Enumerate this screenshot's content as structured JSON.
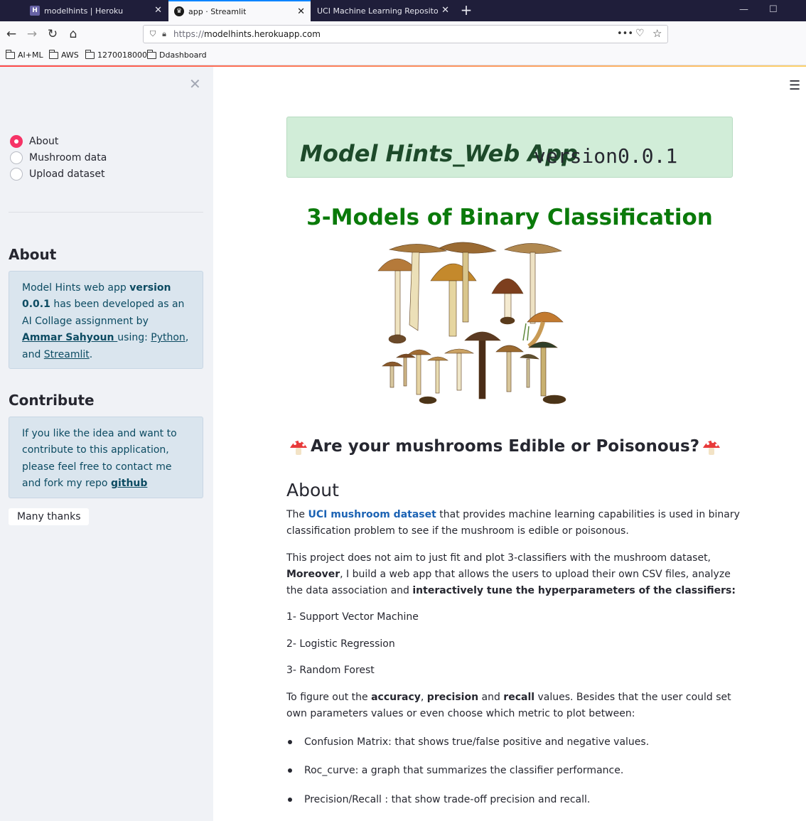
{
  "browser": {
    "tabs": [
      {
        "title": "modelhints | Heroku",
        "favicon": "H",
        "active": false
      },
      {
        "title": "app · Streamlit",
        "favicon": "crown-icon",
        "active": true
      },
      {
        "title": "UCI Machine Learning Repository: I",
        "favicon": "",
        "active": false
      }
    ],
    "url_scheme": "https://",
    "url_host": "modelhints.herokuapp.com",
    "bookmarks": [
      "AI+ML",
      "AWS",
      "1270018000",
      "Ddashboard"
    ]
  },
  "sidebar": {
    "radio_options": [
      {
        "label": "About",
        "selected": true
      },
      {
        "label": "Mushroom data",
        "selected": false
      },
      {
        "label": "Upload dataset",
        "selected": false
      }
    ],
    "about_heading": "About",
    "about_box": {
      "t1": "Model Hints web app ",
      "b1": "version 0.0.1",
      "t2": " has been developed as an AI Collage assignment by ",
      "author": "Ammar Sahyoun ",
      "t3": "using: ",
      "link_python": "Python",
      "t4": ", and ",
      "link_streamlit": "Streamlit",
      "t5": "."
    },
    "contribute_heading": "Contribute",
    "contribute_box": {
      "t1": "If you like the idea and want to contribute to this application, please feel free to contact me and fork my repo ",
      "link": "github"
    },
    "thanks_label": "Many thanks"
  },
  "main": {
    "title": "Model Hints_Web App",
    "version": "version0.0.1",
    "subtitle": "3-Models of Binary Classification",
    "question": "Are your mushrooms Edible or Poisonous?",
    "about_heading": "About",
    "p1": {
      "t1": "The ",
      "link": "UCI mushroom dataset",
      "t2": " that provides machine learning capabilities is used in binary classification problem to see if the mushroom is edible or poisonous."
    },
    "p2": {
      "t1": "This project does not aim to just fit and plot 3-classifiers with the mushroom dataset, ",
      "b1": "Moreover",
      "t2": ", I build a web app that allows the users to upload their own CSV files, analyze the data association and ",
      "b2": "interactively tune the hyperparameters of the classifiers:"
    },
    "models": [
      "1- Support Vector Machine",
      "2- Logistic Regression",
      "3- Random Forest"
    ],
    "p3": {
      "t1": "To figure out the ",
      "b1": "accuracy",
      "t2": ", ",
      "b2": "precision",
      "t3": " and ",
      "b3": "recall",
      "t4": " values. Besides that the user could set own parameters values or even choose which metric to plot between:"
    },
    "metrics": [
      "Confusion Matrix: that shows true/false positive and negative values.",
      "Roc_curve: a graph that summarizes the classifier performance.",
      "Precision/Recall : that show trade-off precision and recall."
    ]
  },
  "colors": {
    "accent": "#f63366",
    "title_box": "#d1edd8",
    "subtitle": "#0a7a0a",
    "info_box": "#dae5ee",
    "link": "#1c63b4"
  }
}
